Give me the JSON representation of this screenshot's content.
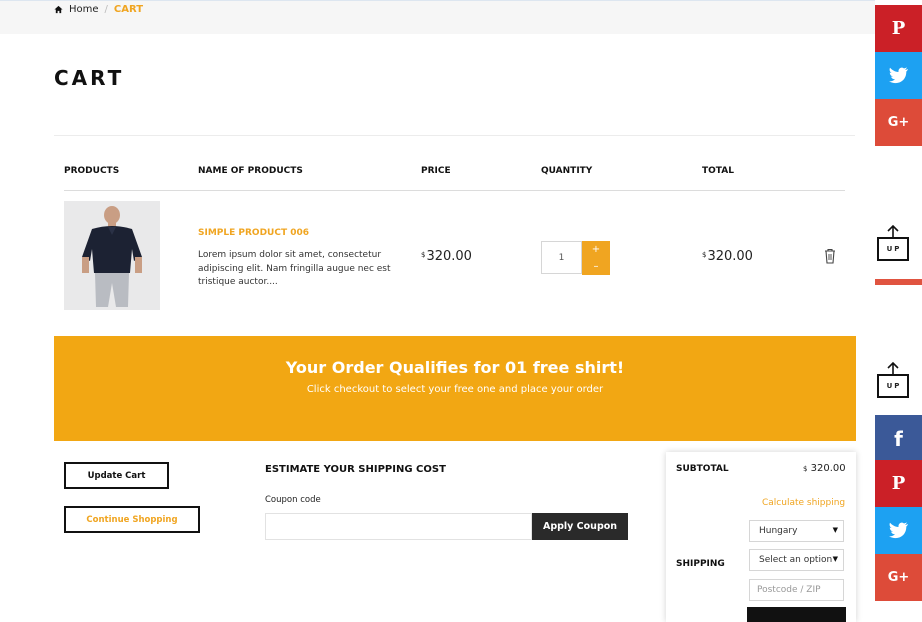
{
  "breadcrumb": {
    "home": "Home",
    "separator": "/",
    "current": "CART"
  },
  "page_title": "CART",
  "table": {
    "headers": [
      "PRODUCTS",
      "NAME OF PRODUCTS",
      "PRICE",
      "QUANTITY",
      "TOTAL"
    ],
    "rows": [
      {
        "name": "SIMPLE PRODUCT 006",
        "description": "Lorem ipsum dolor sit amet, consectetur adipiscing elit. Nam fringilla augue nec est tristique auctor....",
        "currency": "$",
        "price": "320.00",
        "quantity": "1",
        "total": "320.00",
        "image": "navy-polo-shirt"
      }
    ],
    "qty_plus": "+",
    "qty_minus": "–"
  },
  "banner": {
    "headline": "Your Order Qualifies for 01 free shirt!",
    "subtext": "Click checkout to select your free one and place your order",
    "color": "#f2a713"
  },
  "actions": {
    "update_cart": "Update Cart",
    "continue_shopping": "Continue Shopping"
  },
  "shipping": {
    "title": "ESTIMATE YOUR SHIPPING COST",
    "coupon_label": "Coupon code",
    "coupon_value": "",
    "apply_label": "Apply Coupon"
  },
  "totals": {
    "subtotal_label": "SUBTOTAL",
    "subtotal_currency": "$",
    "subtotal_value": "320.00",
    "calculate_link": "Calculate shipping",
    "shipping_label": "SHIPPING",
    "country": "Hungary",
    "state": "Select an option",
    "postcode_placeholder": "Postcode / ZIP"
  },
  "sidebar": {
    "up_label": "UP",
    "icons": [
      "pinterest-icon",
      "twitter-icon",
      "google-plus-icon",
      "facebook-icon",
      "pinterest-icon",
      "twitter-icon",
      "google-plus-icon"
    ],
    "glyphs": {
      "pinterest": "P",
      "google": "G+",
      "facebook": "f"
    },
    "colors": {
      "pinterest": "#cb2027",
      "twitter": "#1da1f2",
      "google": "#dd4b39",
      "facebook": "#3b5998"
    }
  },
  "accent_color": "#f0a521"
}
